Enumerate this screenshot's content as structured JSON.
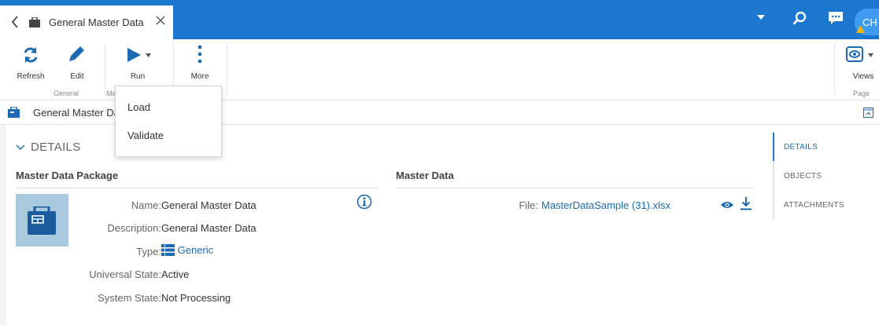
{
  "tab": {
    "title": "General Master Data"
  },
  "user": {
    "initials": "CH"
  },
  "ribbon": {
    "refresh_label": "Refresh",
    "edit_label": "Edit",
    "run_label": "Run",
    "more_label": "More",
    "views_label": "Views",
    "group_general": "General",
    "group_ma": "Ma",
    "group_page": "Page"
  },
  "run_menu": {
    "items": [
      "Load",
      "Validate"
    ]
  },
  "header": {
    "title": "General Master Da"
  },
  "details": {
    "section_label": "DETAILS",
    "package_heading": "Master Data Package",
    "master_heading": "Master Data",
    "fields": {
      "name_label": "Name:",
      "name_value": "General Master Data",
      "desc_label": "Description:",
      "desc_value": "General Master Data",
      "type_label": "Type:",
      "type_value": "Generic",
      "ustate_label": "Universal State:",
      "ustate_value": "Active",
      "sstate_label": "System State:",
      "sstate_value": "Not Processing"
    },
    "file_label": "File:",
    "file_value": "MasterDataSample (31).xlsx"
  },
  "right_nav": {
    "items": [
      "DETAILS",
      "OBJECTS",
      "ATTACHMENTS"
    ],
    "active": 0
  },
  "colors": {
    "brand": "#1c78cf",
    "link": "#1c6ab4",
    "thumb_bg": "#a9c9de"
  }
}
